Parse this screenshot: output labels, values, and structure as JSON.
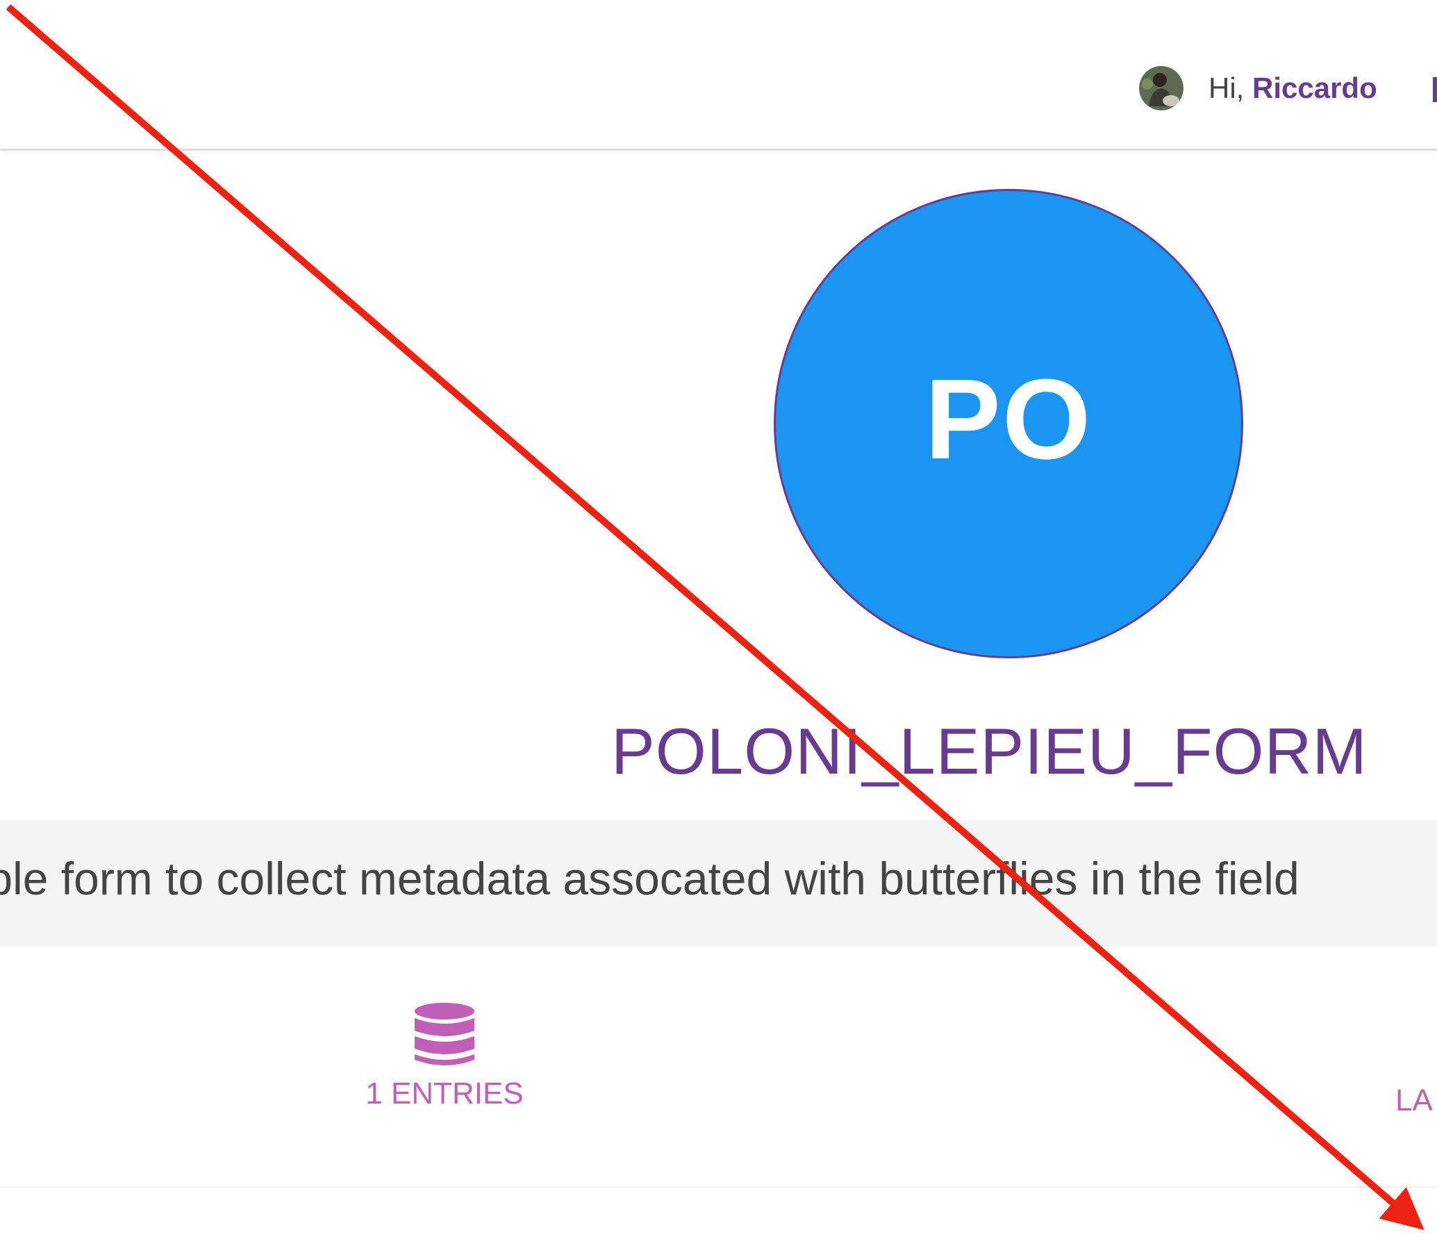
{
  "navbar": {
    "greeting_prefix": "Hi, ",
    "user_name": "Riccardo"
  },
  "project": {
    "logo_initials": "PO",
    "logo_color": "#1a96f2",
    "name": "POLONI_LEPIEU_FORM",
    "description": "A simple form to collect metadata assocated with butterflies in the field"
  },
  "stats": {
    "entries_label": "1 ENTRIES",
    "entries_icon": "database-icon",
    "last_label": "LA"
  },
  "theme": {
    "accent": "#673c90",
    "stat_color": "#c05eb8",
    "annotation_color": "#ee2211"
  }
}
